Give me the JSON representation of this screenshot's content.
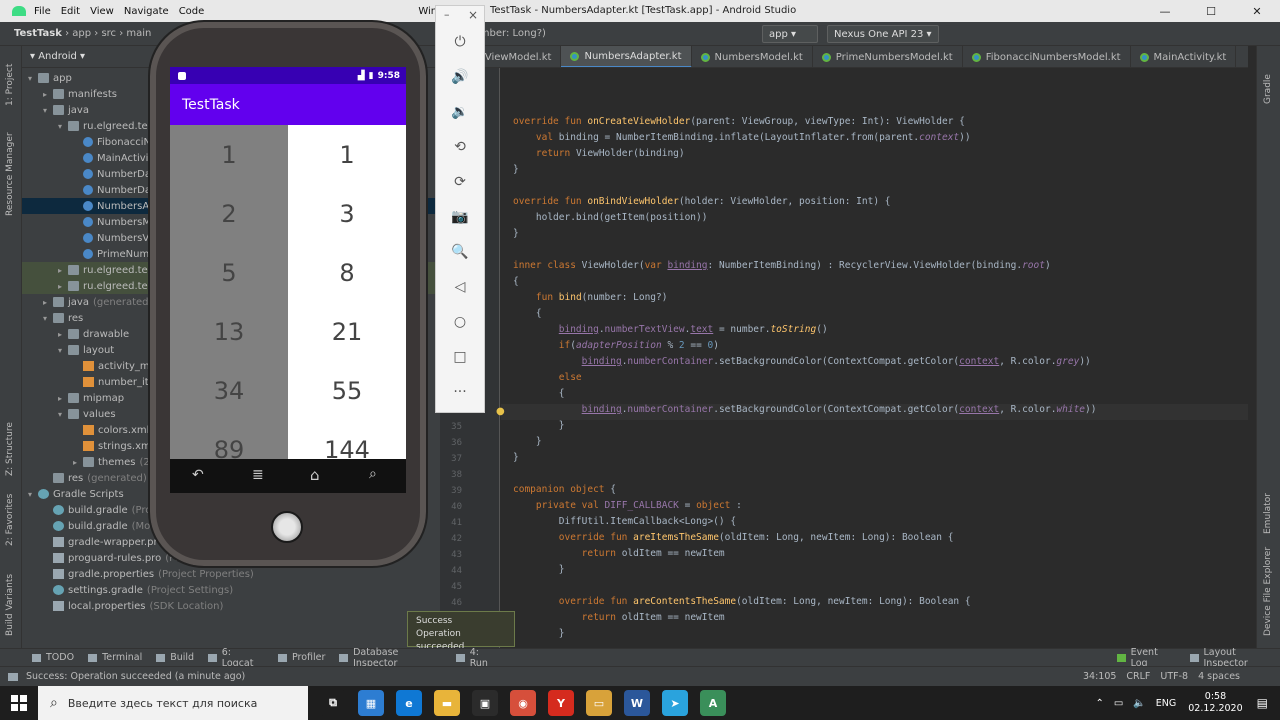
{
  "menubar": {
    "items": [
      "File",
      "Edit",
      "View",
      "Navigate",
      "Code"
    ],
    "window_title": "TestTask - NumbersAdapter.kt [TestTask.app] - Android Studio",
    "window_label_partial": "Window"
  },
  "navbar": {
    "breadcrumb": [
      "TestTask",
      "app",
      "src",
      "main"
    ],
    "code_crumb": "bind(number: Long?)",
    "run_config": "app",
    "device": "Nexus One API 23"
  },
  "tabs": [
    {
      "label": "bersViewModel.kt",
      "active": false
    },
    {
      "label": "NumbersAdapter.kt",
      "active": true
    },
    {
      "label": "NumbersModel.kt",
      "active": false
    },
    {
      "label": "PrimeNumbersModel.kt",
      "active": false
    },
    {
      "label": "FibonacciNumbersModel.kt",
      "active": false
    },
    {
      "label": "MainActivity.kt",
      "active": false
    }
  ],
  "left_stripe": [
    "1: Project",
    "Resource Manager",
    "Z: Structure",
    "2: Favorites",
    "Build Variants"
  ],
  "right_stripe": [
    "Gradle",
    "Emulator",
    "Device File Explorer"
  ],
  "project": {
    "view": "Android",
    "rows": [
      {
        "indent": 0,
        "arrow": "▾",
        "icon": "folder",
        "label": "app",
        "dim": ""
      },
      {
        "indent": 1,
        "arrow": "▸",
        "icon": "folder",
        "label": "manifests",
        "dim": ""
      },
      {
        "indent": 1,
        "arrow": "▾",
        "icon": "folder",
        "label": "java",
        "dim": ""
      },
      {
        "indent": 2,
        "arrow": "▾",
        "icon": "folder",
        "label": "ru.elgreed.testt",
        "dim": ""
      },
      {
        "indent": 3,
        "arrow": "",
        "icon": "kt",
        "label": "FibonacciN",
        "dim": ""
      },
      {
        "indent": 3,
        "arrow": "",
        "icon": "kt",
        "label": "MainActivi",
        "dim": ""
      },
      {
        "indent": 3,
        "arrow": "",
        "icon": "kt",
        "label": "NumberDa",
        "dim": ""
      },
      {
        "indent": 3,
        "arrow": "",
        "icon": "kt",
        "label": "NumberDa",
        "dim": ""
      },
      {
        "indent": 3,
        "arrow": "",
        "icon": "kt",
        "label": "NumbersA",
        "dim": "",
        "sel": true
      },
      {
        "indent": 3,
        "arrow": "",
        "icon": "kt",
        "label": "NumbersM",
        "dim": ""
      },
      {
        "indent": 3,
        "arrow": "",
        "icon": "kt",
        "label": "NumbersVi",
        "dim": ""
      },
      {
        "indent": 3,
        "arrow": "",
        "icon": "kt",
        "label": "PrimeNum",
        "dim": ""
      },
      {
        "indent": 2,
        "arrow": "▸",
        "icon": "folder",
        "label": "ru.elgreed.test",
        "dim": "",
        "hl": true
      },
      {
        "indent": 2,
        "arrow": "▸",
        "icon": "folder",
        "label": "ru.elgreed.test",
        "dim": "",
        "hl": true
      },
      {
        "indent": 1,
        "arrow": "▸",
        "icon": "folder",
        "label": "java",
        "dim": "(generated)"
      },
      {
        "indent": 1,
        "arrow": "▾",
        "icon": "folder",
        "label": "res",
        "dim": ""
      },
      {
        "indent": 2,
        "arrow": "▸",
        "icon": "folder",
        "label": "drawable",
        "dim": ""
      },
      {
        "indent": 2,
        "arrow": "▾",
        "icon": "folder",
        "label": "layout",
        "dim": ""
      },
      {
        "indent": 3,
        "arrow": "",
        "icon": "xml",
        "label": "activity_ma",
        "dim": ""
      },
      {
        "indent": 3,
        "arrow": "",
        "icon": "xml",
        "label": "number_ite",
        "dim": ""
      },
      {
        "indent": 2,
        "arrow": "▸",
        "icon": "folder",
        "label": "mipmap",
        "dim": ""
      },
      {
        "indent": 2,
        "arrow": "▾",
        "icon": "folder",
        "label": "values",
        "dim": ""
      },
      {
        "indent": 3,
        "arrow": "",
        "icon": "xml",
        "label": "colors.xml",
        "dim": ""
      },
      {
        "indent": 3,
        "arrow": "",
        "icon": "xml",
        "label": "strings.xml",
        "dim": ""
      },
      {
        "indent": 3,
        "arrow": "▸",
        "icon": "folder",
        "label": "themes",
        "dim": "(2)"
      },
      {
        "indent": 1,
        "arrow": "",
        "icon": "folder",
        "label": "res",
        "dim": "(generated)"
      },
      {
        "indent": 0,
        "arrow": "▾",
        "icon": "gr",
        "label": "Gradle Scripts",
        "dim": ""
      },
      {
        "indent": 1,
        "arrow": "",
        "icon": "gr",
        "label": "build.gradle",
        "dim": "(Proje"
      },
      {
        "indent": 1,
        "arrow": "",
        "icon": "gr",
        "label": "build.gradle",
        "dim": "(Modu"
      },
      {
        "indent": 1,
        "arrow": "",
        "icon": "file",
        "label": "gradle-wrapper.prop",
        "dim": ""
      },
      {
        "indent": 1,
        "arrow": "",
        "icon": "file",
        "label": "proguard-rules.pro",
        "dim": "(Proc"
      },
      {
        "indent": 1,
        "arrow": "",
        "icon": "file",
        "label": "gradle.properties",
        "dim": "(Project Properties)"
      },
      {
        "indent": 1,
        "arrow": "",
        "icon": "gr",
        "label": "settings.gradle",
        "dim": "(Project Settings)"
      },
      {
        "indent": 1,
        "arrow": "",
        "icon": "file",
        "label": "local.properties",
        "dim": "(SDK Location)"
      }
    ]
  },
  "editor": {
    "line_numbers": [
      "35",
      "36",
      "37",
      "38",
      "39",
      "40",
      "41",
      "42",
      "43",
      "44",
      "45",
      "46"
    ],
    "lines": [
      {
        "h": "<span class='kw'>override fun </span><span class='fn'>onCreateViewHolder</span>(parent: ViewGroup, viewType: Int): ViewHolder {"
      },
      {
        "h": "    <span class='kw'>val </span>binding = NumberItemBinding.inflate(LayoutInflater.from(parent.<span class='pr it'>context</span>))"
      },
      {
        "h": "    <span class='kw'>return </span>ViewHolder(binding)"
      },
      {
        "h": "}"
      },
      {
        "h": ""
      },
      {
        "h": "<span class='kw'>override fun </span><span class='fn'>onBindViewHolder</span>(holder: ViewHolder, position: Int) {"
      },
      {
        "h": "    holder.bind(getItem(position))"
      },
      {
        "h": "}"
      },
      {
        "h": ""
      },
      {
        "h": "<span class='kw'>inner class </span>ViewHolder(<span class='kw'>var </span><span class='pr ul'>binding</span>: NumberItemBinding) : RecyclerView.ViewHolder(binding.<span class='pr it'>root</span>)"
      },
      {
        "h": "{"
      },
      {
        "h": "    <span class='kw'>fun </span><span class='fn'>bind</span>(number: Long?)"
      },
      {
        "h": "    {"
      },
      {
        "h": "        <span class='pr ul'>binding</span>.<span class='pr'>numberTextView</span>.<span class='pr ul'>text</span> = number.<span class='fn it'>toString</span>()"
      },
      {
        "h": "        <span class='kw'>if</span>(<span class='pr it'>adapterPosition</span> % <span class='num'>2</span> == <span class='num'>0</span>)"
      },
      {
        "h": "            <span class='pr ul'>binding</span>.<span class='pr'>numberContainer</span>.setBackgroundColor(ContextCompat.getColor(<span class='pr ul'>context</span>, R.color.<span class='pr it'>grey</span>))"
      },
      {
        "h": "        <span class='kw'>else</span>"
      },
      {
        "h": "        {"
      },
      {
        "h": "            <span class='pr ul'>binding</span>.<span class='pr'>numberContainer</span>.setBackgroundColor(ContextCompat.getColor(<span class='pr ul'>context</span>, R.color.<span class='pr it'>white</span>))"
      },
      {
        "h": "        }"
      },
      {
        "h": "    }"
      },
      {
        "h": "}"
      },
      {
        "h": ""
      },
      {
        "h": "<span class='kw'>companion object </span>{"
      },
      {
        "h": "    <span class='kw'>private val </span><span class='pr'>DIFF_CALLBACK</span> = <span class='kw'>object </span>:"
      },
      {
        "h": "        DiffUtil.ItemCallback&lt;Long&gt;() {"
      },
      {
        "h": "        <span class='kw'>override fun </span><span class='fn'>areItemsTheSame</span>(oldItem: Long, newItem: Long): Boolean {"
      },
      {
        "h": "            <span class='kw'>return </span>oldItem == newItem"
      },
      {
        "h": "        }"
      },
      {
        "h": ""
      },
      {
        "h": "        <span class='kw'>override fun </span><span class='fn'>areContentsTheSame</span>(oldItem: Long, newItem: Long): Boolean {"
      },
      {
        "h": "            <span class='kw'>return </span>oldItem == newItem"
      },
      {
        "h": "        }"
      }
    ]
  },
  "emulator_toolbar": {
    "icons": [
      "power-icon",
      "volume-up-icon",
      "volume-down-icon",
      "rotate-left-icon",
      "rotate-right-icon",
      "camera-icon",
      "zoom-icon",
      "back-icon",
      "home-icon",
      "overview-icon",
      "more-icon"
    ],
    "glyphs": [
      "⏻",
      "🔊",
      "🔉",
      "⟲",
      "⟳",
      "📷",
      "🔍",
      "◁",
      "○",
      "□",
      "···"
    ],
    "close": "×",
    "minimize": "–"
  },
  "phone": {
    "status_time": "9:58",
    "app_title": "TestTask",
    "numbers": [
      [
        "1",
        "1"
      ],
      [
        "2",
        "3"
      ],
      [
        "5",
        "8"
      ],
      [
        "13",
        "21"
      ],
      [
        "34",
        "55"
      ],
      [
        "89",
        "144"
      ]
    ],
    "colors": {
      "statusbar": "#3700b3",
      "appbar": "#6200ee",
      "grey_cell": "#808080"
    }
  },
  "toast": {
    "title": "Success",
    "message": "Operation succeeded"
  },
  "bottombar": {
    "tools": [
      "TODO",
      "Terminal",
      "Build",
      "6: Logcat",
      "Profiler",
      "Database Inspector",
      "4: Run"
    ],
    "right_tools": [
      "Event Log",
      "Layout Inspector"
    ]
  },
  "statusbar": {
    "message": "Success: Operation succeeded (a minute ago)",
    "position": "34:105",
    "line_sep": "CRLF",
    "encoding": "UTF-8",
    "indent": "4 spaces"
  },
  "taskbar": {
    "search_placeholder": "Введите здесь текст для поиска",
    "lang": "ENG",
    "time": "0:58",
    "date": "02.12.2020",
    "apps": [
      {
        "name": "task-view-icon",
        "glyph": "⧉",
        "color": "#1e1e1e"
      },
      {
        "name": "calculator-icon",
        "glyph": "▦",
        "color": "#2d7dd2"
      },
      {
        "name": "edge-icon",
        "glyph": "e",
        "color": "#0f78d4"
      },
      {
        "name": "explorer-icon",
        "glyph": "▬",
        "color": "#e8b43a"
      },
      {
        "name": "store-icon",
        "glyph": "▣",
        "color": "#2b2b2b"
      },
      {
        "name": "chrome-icon",
        "glyph": "◉",
        "color": "#d64f3b"
      },
      {
        "name": "yandex-icon",
        "glyph": "Y",
        "color": "#d52b1e"
      },
      {
        "name": "folder-icon",
        "glyph": "▭",
        "color": "#d8a23a"
      },
      {
        "name": "word-icon",
        "glyph": "W",
        "color": "#2b579a"
      },
      {
        "name": "telegram-icon",
        "glyph": "➤",
        "color": "#2aa3dd"
      },
      {
        "name": "android-studio-icon",
        "glyph": "A",
        "color": "#3a8f5a"
      }
    ]
  }
}
